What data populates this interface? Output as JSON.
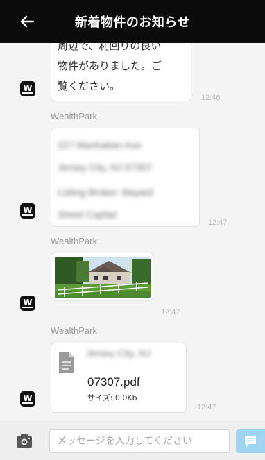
{
  "header": {
    "title": "新着物件のお知らせ",
    "back_icon": "arrow-left-icon"
  },
  "avatar_letter": "W",
  "messages": [
    {
      "text_lines": [
        "周辺で、利回りの良い",
        "物件がありました。ご",
        "覧ください。"
      ],
      "time": "12:46"
    },
    {
      "sender": "WealthPark",
      "address_lines": [
        "227 Manhattan Ave",
        "Jersey City, NJ 07307"
      ],
      "broker_lines": [
        "Listing Broker: Bayard",
        "Street Capital"
      ],
      "time": "12:47"
    },
    {
      "sender": "WealthPark",
      "attachment": "photo",
      "time": "12:47"
    },
    {
      "sender": "WealthPark",
      "file_caption": "Jersey City, NJ",
      "file_name": "07307.pdf",
      "file_size": "サイズ: 0.0Kb",
      "time": "12:47"
    }
  ],
  "input_bar": {
    "placeholder": "メッセージを入力してください",
    "camera_icon": "camera-icon",
    "send_icon": "send-message-icon"
  },
  "colors": {
    "header_bg": "#0b0b0b",
    "send_button": "#9fd3f2",
    "chat_bg": "#f4f4f4"
  }
}
